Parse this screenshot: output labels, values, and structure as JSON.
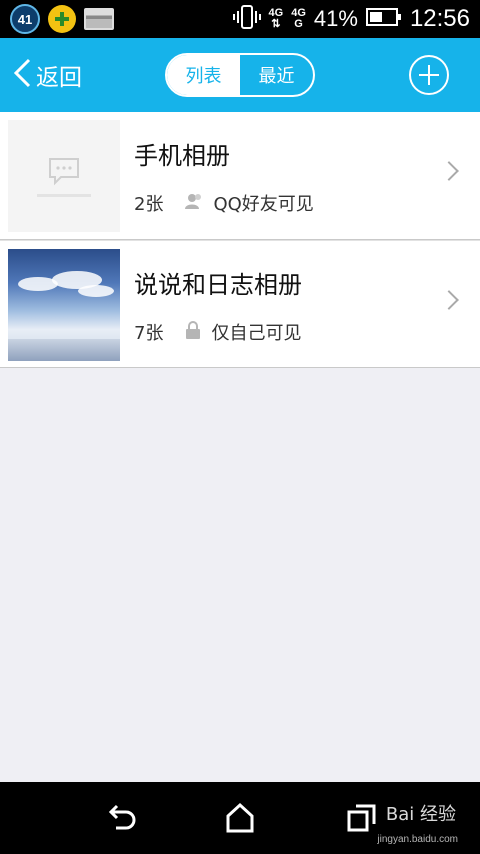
{
  "status_bar": {
    "notification_count": "41",
    "network_type": "4G",
    "network_small_top": "4G",
    "network_small_bottom": "G",
    "battery_percent": "41%",
    "time": "12:56"
  },
  "header": {
    "back_label": "返回",
    "tabs": [
      {
        "label": "列表",
        "active": true
      },
      {
        "label": "最近",
        "active": false
      }
    ]
  },
  "albums": [
    {
      "title": "手机相册",
      "count": "2张",
      "visibility": "QQ好友可见",
      "visibility_icon": "friend-icon"
    },
    {
      "title": "说说和日志相册",
      "count": "7张",
      "visibility": "仅自己可见",
      "visibility_icon": "lock-icon"
    }
  ],
  "watermark": {
    "brand": "Bai 经验",
    "url": "jingyan.baidu.com"
  },
  "colors": {
    "accent": "#16b3ea",
    "background": "#efeff4"
  }
}
